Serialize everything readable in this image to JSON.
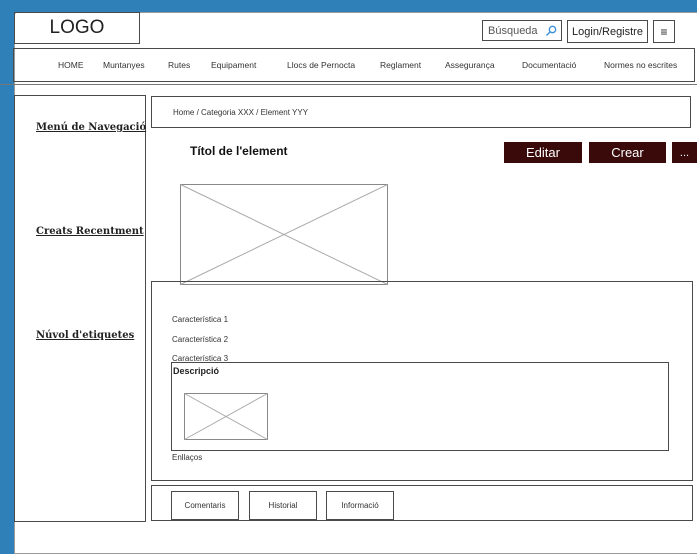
{
  "header": {
    "logo": "LOGO",
    "search_placeholder": "Búsqueda",
    "login_label": "Login/Registre",
    "menu_glyph": "≡"
  },
  "nav": {
    "items": [
      "HOME",
      "Muntanyes",
      "Rutes",
      "Equipament",
      "Llocs de Pernocta",
      "Reglament",
      "Assegurança",
      "Documentació",
      "Normes no escrites"
    ]
  },
  "sidebar": {
    "nav_menu": "Menú de Navegació",
    "recent": "Creats Recentment",
    "tags": "Núvol d'etiquetes"
  },
  "breadcrumb": "Home / Categoria XXX / Element YYY",
  "element": {
    "title": "Títol de l'element",
    "edit_label": "Editar",
    "create_label": "Crear",
    "more_label": "..."
  },
  "details": {
    "features": [
      "Característica 1",
      "Característica 2",
      "Característica 3"
    ],
    "description_label": "Descripció",
    "links_label": "Enllaços"
  },
  "tabs": [
    "Comentaris",
    "Historial",
    "Informació"
  ],
  "icons": {
    "search": "search-icon",
    "menu": "hamburger-menu-icon",
    "image": "image-placeholder-icon"
  },
  "colors": {
    "background": "#2f7fb9",
    "button_dark": "#3a0a0a"
  }
}
